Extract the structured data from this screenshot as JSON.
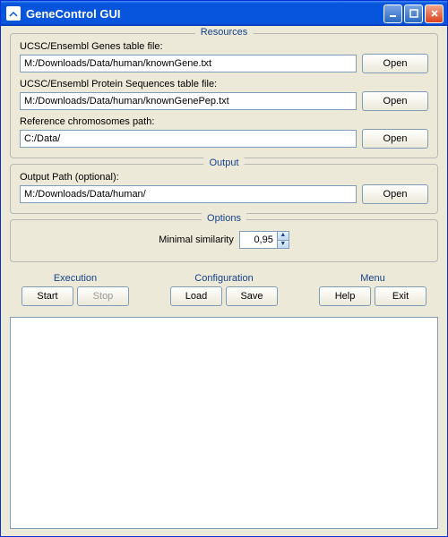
{
  "window": {
    "title": "GeneControl GUI"
  },
  "resources": {
    "title": "Resources",
    "genes_label": "UCSC/Ensembl Genes table file:",
    "genes_value": "M:/Downloads/Data/human/knownGene.txt",
    "genes_open": "Open",
    "protein_label": "UCSC/Ensembl Protein Sequences table file:",
    "protein_value": "M:/Downloads/Data/human/knownGenePep.txt",
    "protein_open": "Open",
    "chrom_label": "Reference chromosomes path:",
    "chrom_value": "C:/Data/",
    "chrom_open": "Open"
  },
  "output": {
    "title": "Output",
    "path_label": "Output Path (optional):",
    "path_value": "M:/Downloads/Data/human/",
    "path_open": "Open"
  },
  "options": {
    "title": "Options",
    "sim_label": "Minimal similarity",
    "sim_value": "0,95"
  },
  "execution": {
    "title": "Execution",
    "start": "Start",
    "stop": "Stop"
  },
  "configuration": {
    "title": "Configuration",
    "load": "Load",
    "save": "Save"
  },
  "menu": {
    "title": "Menu",
    "help": "Help",
    "exit": "Exit"
  }
}
